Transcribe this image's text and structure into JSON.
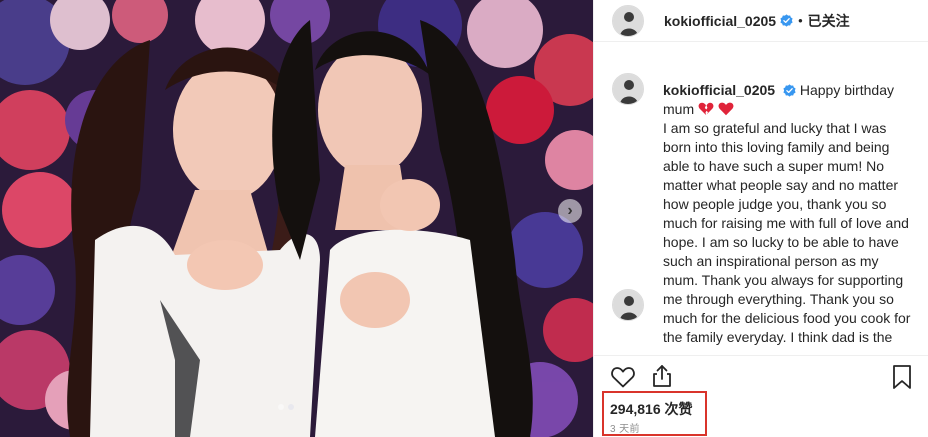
{
  "post": {
    "username": "kokiofficial_0205",
    "follow_status": "已关注",
    "header_separator": "•",
    "caption": {
      "username": "kokiofficial_0205",
      "greeting": "Happy birthday mum",
      "emojis": [
        "broken-heart-emoji",
        "red-heart-emoji"
      ],
      "body": "I am so grateful and lucky that I was born into this loving family and being able to have such a super mum! No matter what people say and no matter how people judge you, thank you so much for raising me with full of love and hope. I am so lucky to be able to have such an inspirational person as my mum. Thank you always for supporting me through everything. Thank you so much for the delicious food you cook for the family everyday. I think dad is the"
    },
    "likes_label": "294,816 次赞",
    "timestamp": "3 天前",
    "icons": {
      "like": "heart-outline-icon",
      "share": "share-upload-icon",
      "save": "bookmark-icon",
      "verified": "verified-badge-icon",
      "next": "chevron-right-icon"
    },
    "carousel": {
      "dots": 2,
      "active_index": 1
    },
    "colors": {
      "verified_blue": "#3897f0",
      "heart_red": "#ed4956",
      "highlight_red": "#d9342b",
      "muted_text": "#8e8e8e"
    }
  }
}
